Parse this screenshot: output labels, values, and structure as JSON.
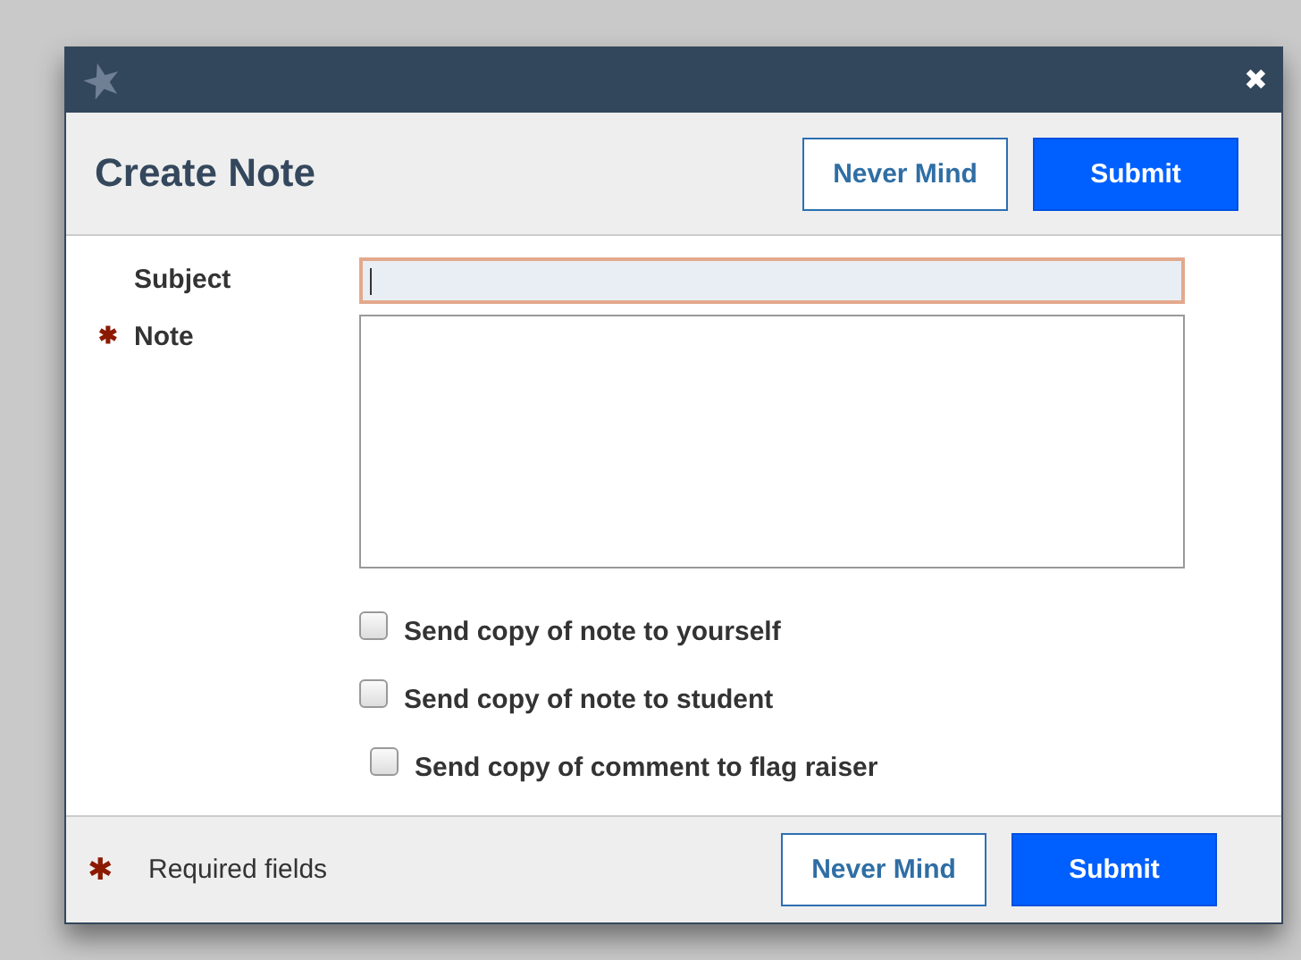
{
  "window": {
    "close_icon": "✖"
  },
  "header": {
    "title": "Create Note",
    "buttons": [
      {
        "label": "Never Mind",
        "kind": "secondary"
      },
      {
        "label": "Submit",
        "kind": "primary"
      }
    ]
  },
  "fields": [
    {
      "label": "Subject",
      "kind": "input",
      "required": false,
      "focused": true
    },
    {
      "label": "Note",
      "kind": "textarea",
      "required": true,
      "focused": false
    }
  ],
  "required_mark": "✱",
  "checkboxes": [
    {
      "label": "Send copy of note to yourself",
      "checked": false
    },
    {
      "label": "Send copy of note to student",
      "checked": false
    },
    {
      "label": "Send copy of comment to flag raiser",
      "checked": false
    }
  ],
  "footer": {
    "required_mark": "✱",
    "note": "Required fields",
    "buttons": [
      {
        "label": "Never Mind",
        "kind": "secondary"
      },
      {
        "label": "Submit",
        "kind": "primary"
      }
    ]
  }
}
